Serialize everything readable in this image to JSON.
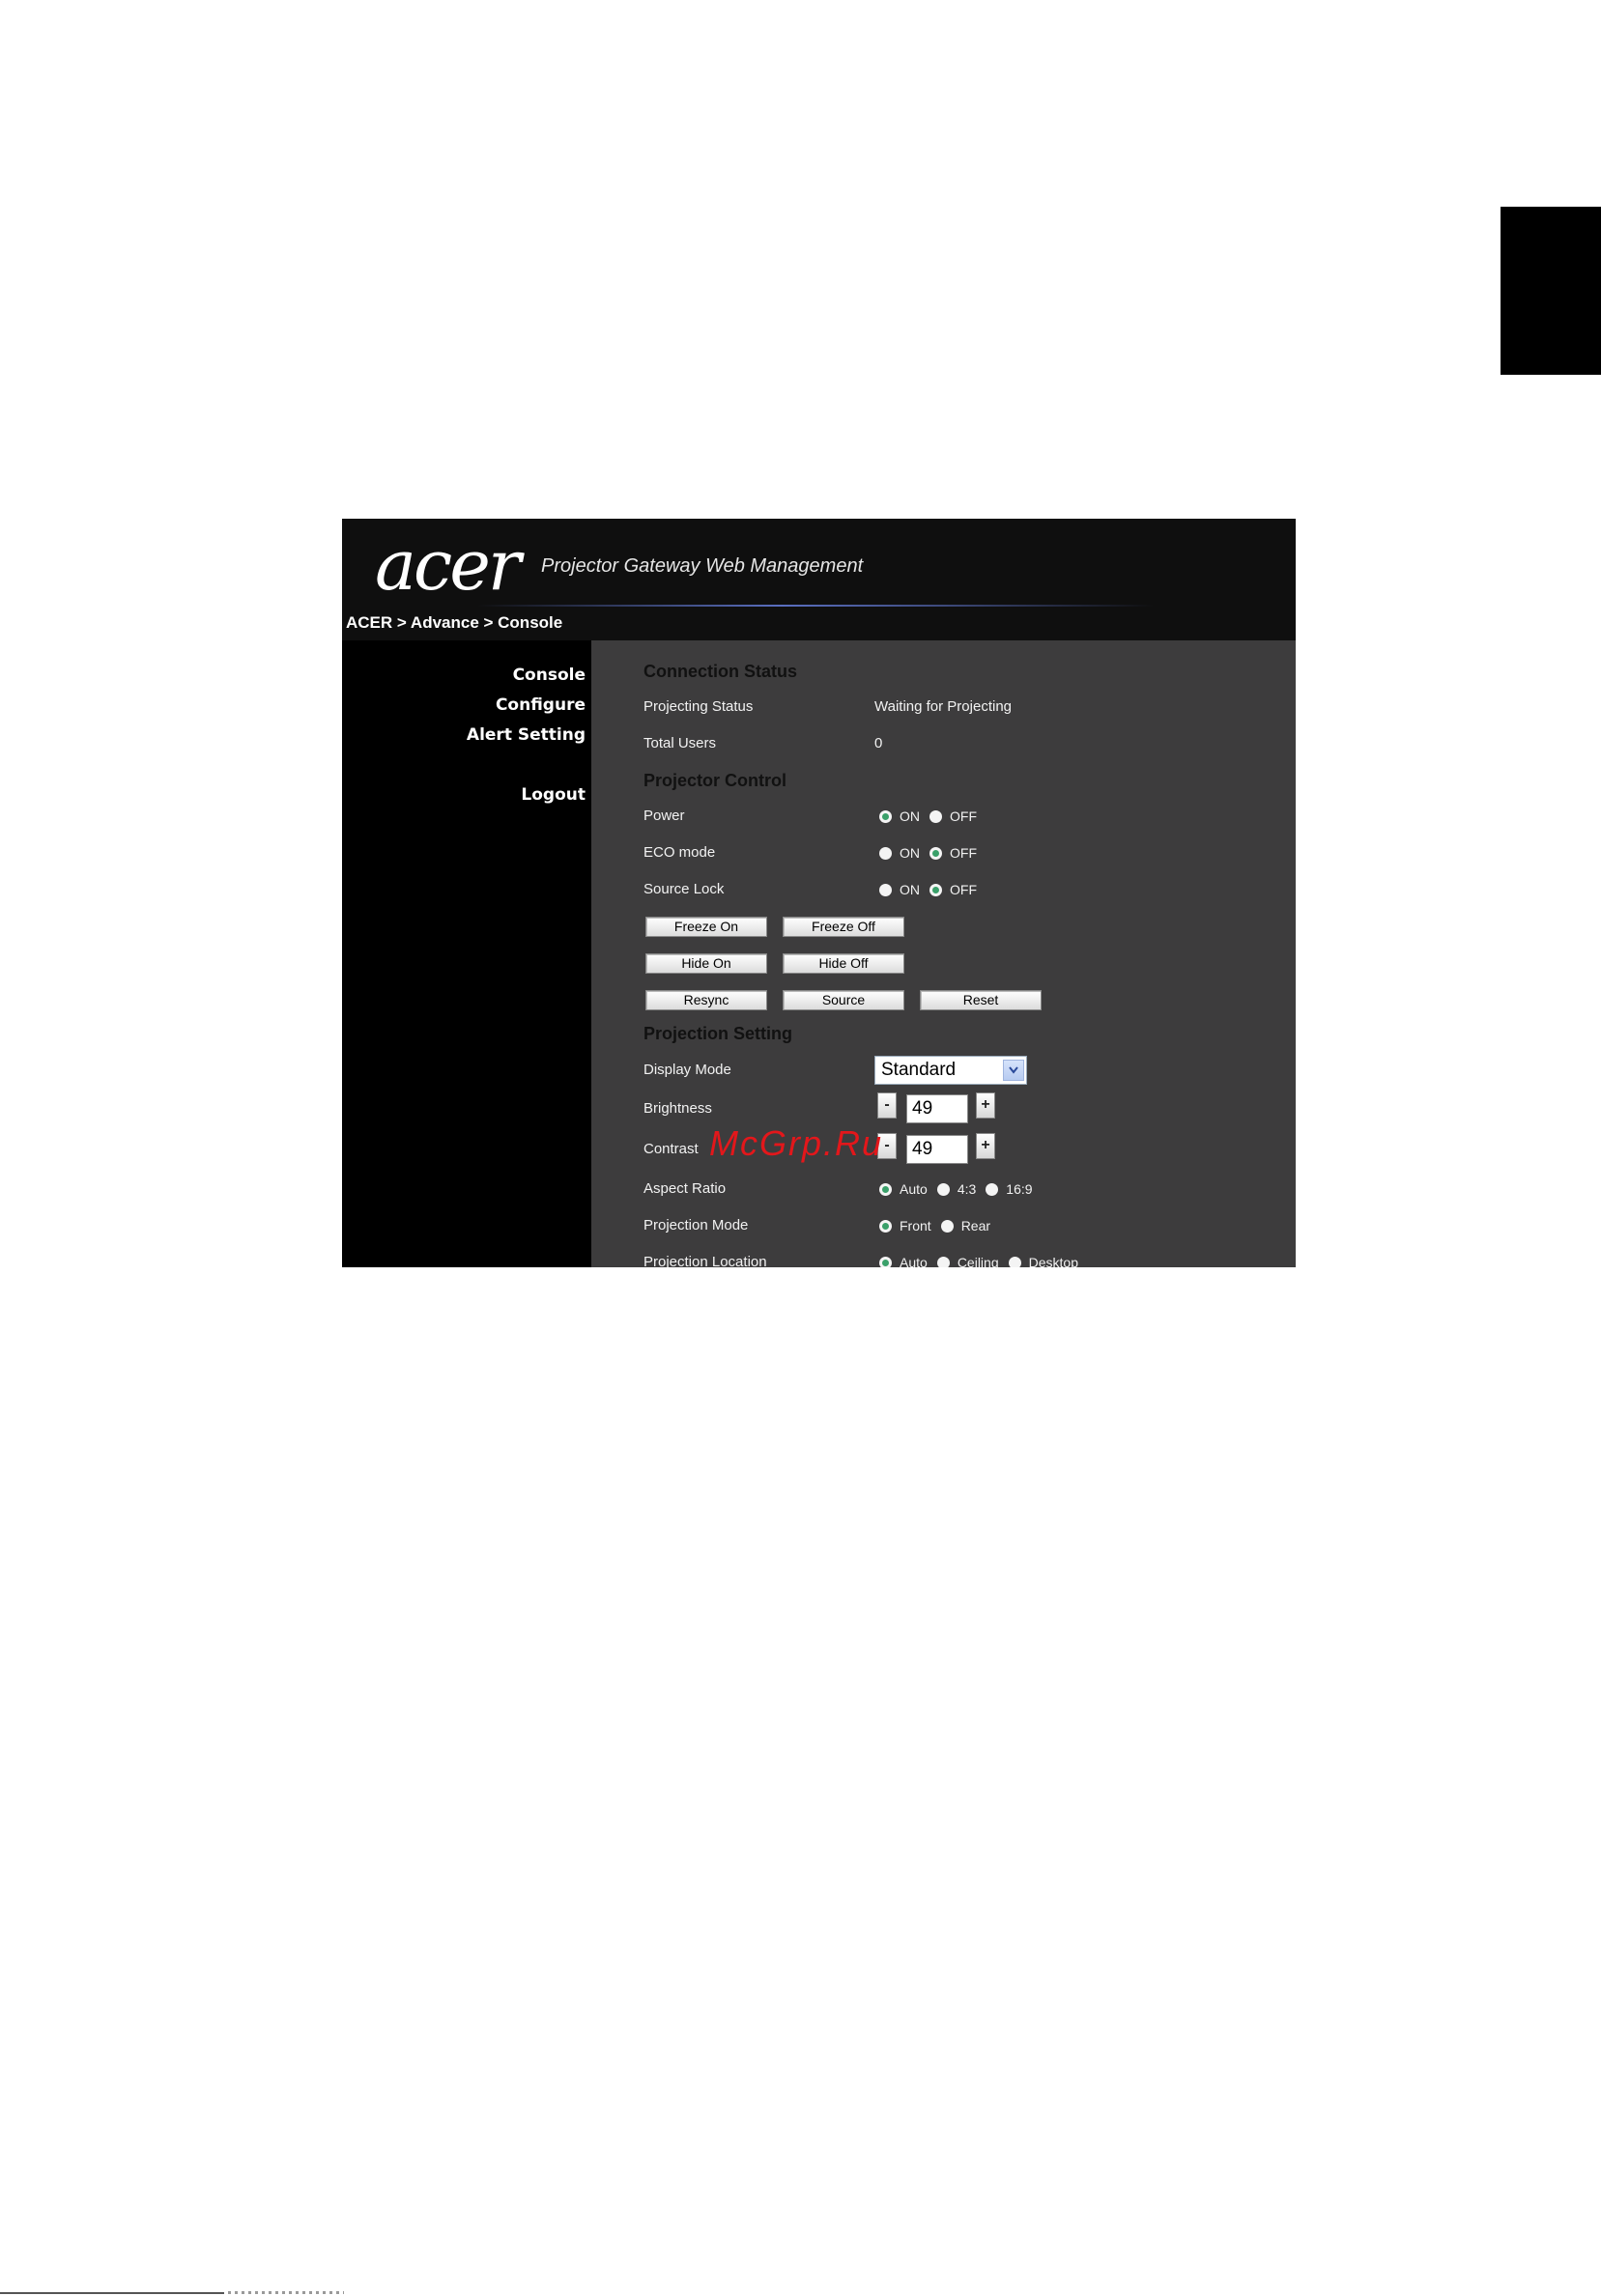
{
  "app": {
    "logo": "acer",
    "title": "Projector Gateway Web Management",
    "breadcrumb": "ACER > Advance > Console"
  },
  "nav": {
    "console": "Console",
    "configure": "Configure",
    "alert_setting": "Alert Setting",
    "logout": "Logout"
  },
  "connection": {
    "heading": "Connection Status",
    "projecting_status_label": "Projecting Status",
    "projecting_status_value": "Waiting for Projecting",
    "total_users_label": "Total Users",
    "total_users_value": "0"
  },
  "control": {
    "heading": "Projector Control",
    "power": {
      "label": "Power",
      "on": "ON",
      "off": "OFF",
      "selected": "ON"
    },
    "eco": {
      "label": "ECO mode",
      "on": "ON",
      "off": "OFF",
      "selected": "OFF"
    },
    "source_lock": {
      "label": "Source Lock",
      "on": "ON",
      "off": "OFF",
      "selected": "OFF"
    },
    "buttons": {
      "freeze_on": "Freeze On",
      "freeze_off": "Freeze Off",
      "hide_on": "Hide On",
      "hide_off": "Hide Off",
      "resync": "Resync",
      "source": "Source",
      "reset": "Reset"
    }
  },
  "projection": {
    "heading": "Projection Setting",
    "display_mode": {
      "label": "Display Mode",
      "value": "Standard"
    },
    "brightness": {
      "label": "Brightness",
      "minus": "-",
      "value": "49",
      "plus": "+"
    },
    "contrast": {
      "label": "Contrast",
      "minus": "-",
      "value": "49",
      "plus": "+"
    },
    "aspect_ratio": {
      "label": "Aspect Ratio",
      "options": [
        "Auto",
        "4:3",
        "16:9"
      ],
      "selected": "Auto"
    },
    "projection_mode": {
      "label": "Projection Mode",
      "options": [
        "Front",
        "Rear"
      ],
      "selected": "Front"
    },
    "projection_location": {
      "label": "Projection Location",
      "options": [
        "Auto",
        "Ceiling",
        "Desktop"
      ],
      "selected": "Auto"
    }
  },
  "watermark": "McGrp.Ru",
  "colors": {
    "main_bg": "#3d3c3d",
    "sidebar_bg": "#000000",
    "radio_selected": "#3aa06a",
    "watermark": "#e3171b"
  }
}
